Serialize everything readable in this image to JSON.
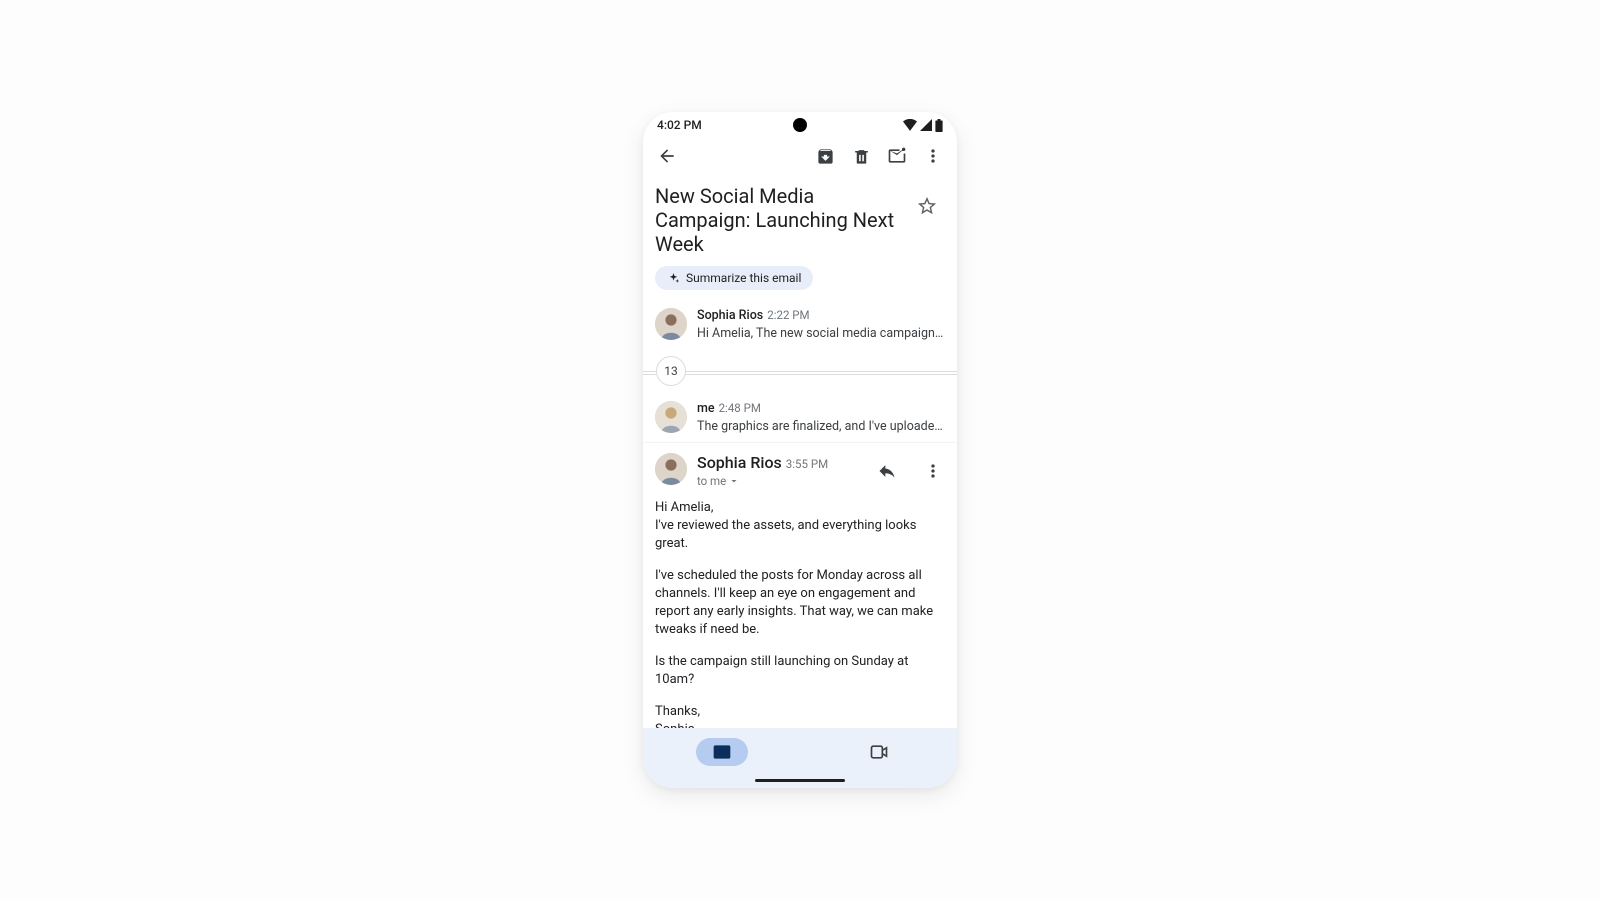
{
  "status": {
    "time": "4:02 PM"
  },
  "subject": "New Social Media Campaign: Launching Next Week",
  "chip_label": "Summarize this email",
  "thread_count": "13",
  "messages": {
    "m0": {
      "name": "Sophia Rios",
      "time": "2:22 PM",
      "snippet": "Hi Amelia, The new social media campaign for ou…"
    },
    "m1": {
      "name": "me",
      "time": "2:48 PM",
      "snippet": "The graphics are finalized, and I've uploaded the…"
    },
    "m2": {
      "name": "Sophia Rios",
      "time": "3:55 PM",
      "to": "to me"
    }
  },
  "body": {
    "p1": "Hi Amelia,",
    "p2": "I've reviewed the assets, and everything looks great.",
    "p3": "I've scheduled the posts for Monday across all channels. I'll keep an eye on engagement and report any early insights. That way, we can make tweaks if need be.",
    "p4": "Is the campaign still launching on Sunday at 10am?",
    "p5": "Thanks,",
    "p6": "Sophia"
  }
}
